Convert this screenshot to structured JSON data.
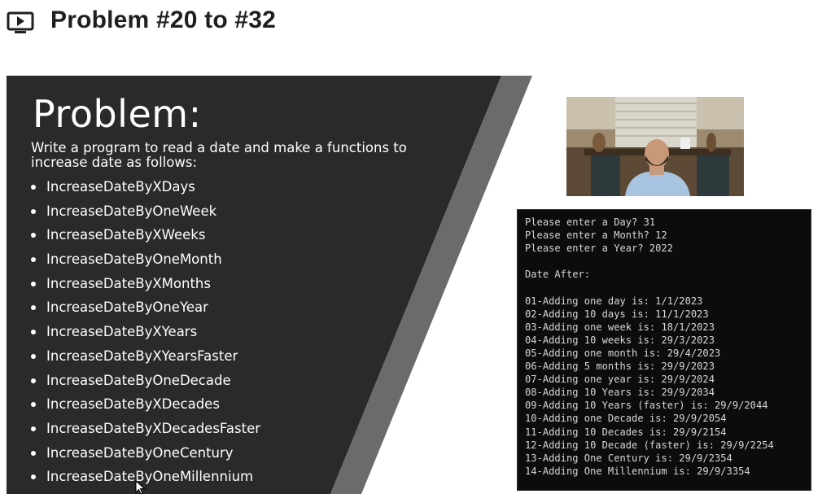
{
  "header": {
    "title": "Problem #20 to #32",
    "icon": "video-lesson-icon"
  },
  "slide": {
    "heading": "Problem:",
    "intro": "Write a program to read a date and make a functions to increase date as follows:",
    "functions": [
      "IncreaseDateByXDays",
      "IncreaseDateByOneWeek",
      "IncreaseDateByXWeeks",
      "IncreaseDateByOneMonth",
      "IncreaseDateByXMonths",
      "IncreaseDateByOneYear",
      "IncreaseDateByXYears",
      "IncreaseDateByXYearsFaster",
      "IncreaseDateByOneDecade",
      "IncreaseDateByXDecades",
      "IncreaseDateByXDecadesFaster",
      "IncreaseDateByOneCentury",
      "IncreaseDateByOneMillennium"
    ],
    "colors": {
      "background": "#2a2a2a",
      "stripe": "#6b6b6b",
      "text": "#ffffff"
    }
  },
  "console": {
    "lines": [
      "Please enter a Day? 31",
      "Please enter a Month? 12",
      "Please enter a Year? 2022",
      "",
      "Date After:",
      "",
      "01-Adding one day is: 1/1/2023",
      "02-Adding 10 days is: 11/1/2023",
      "03-Adding one week is: 18/1/2023",
      "04-Adding 10 weeks is: 29/3/2023",
      "05-Adding one month is: 29/4/2023",
      "06-Adding 5 months is: 29/9/2023",
      "07-Adding one year is: 29/9/2024",
      "08-Adding 10 Years is: 29/9/2034",
      "09-Adding 10 Years (faster) is: 29/9/2044",
      "10-Adding one Decade is: 29/9/2054",
      "11-Adding 10 Decades is: 29/9/2154",
      "12-Adding 10 Decade (faster) is: 29/9/2254",
      "13-Adding One Century is: 29/9/2354",
      "14-Adding One Millennium is: 29/9/3354"
    ],
    "colors": {
      "background": "#0c0c0c",
      "text": "#d6d6d6"
    }
  },
  "webcam": {
    "icon": "presenter-webcam-image"
  }
}
